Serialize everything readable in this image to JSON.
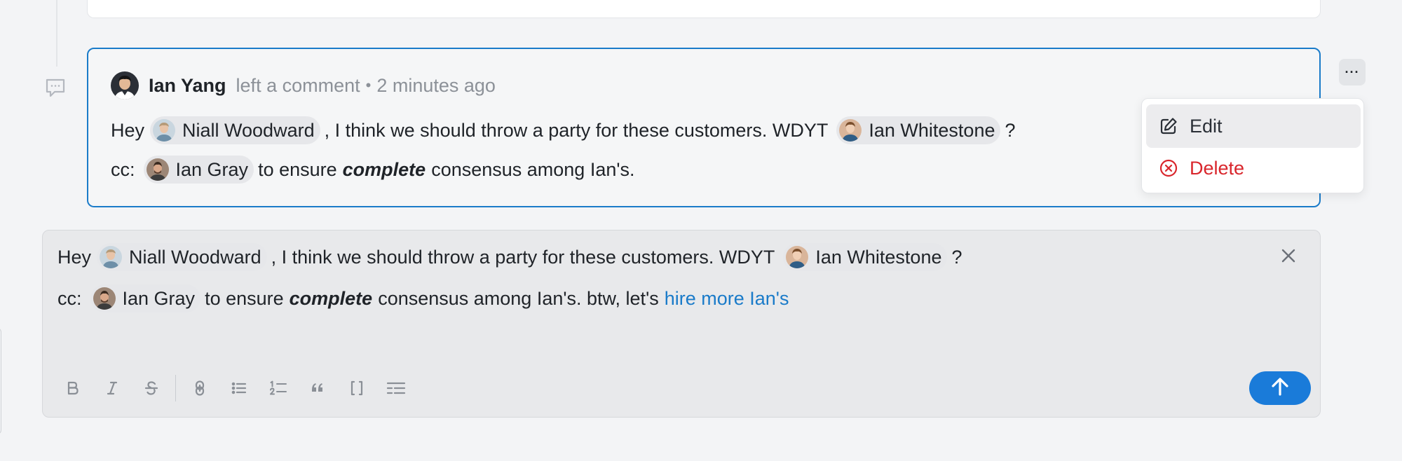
{
  "comment": {
    "author": "Ian Yang",
    "action": "left a comment",
    "separator": "•",
    "time": "2 minutes ago",
    "line1": {
      "pre": "Hey",
      "mention1": "Niall Woodward",
      "mid": ", I think we should throw a party for these customers. WDYT",
      "mention2": "Ian Whitestone",
      "end": "?"
    },
    "line2": {
      "cc": "cc:",
      "mention": "Ian Gray",
      "pre": "to ensure",
      "emph": "complete",
      "post": "consensus among Ian's."
    }
  },
  "menu": {
    "more_label": "···",
    "edit": "Edit",
    "delete": "Delete"
  },
  "editor": {
    "line1": {
      "pre": "Hey",
      "mention1": "Niall Woodward",
      "mid": ", I think we should throw a party for these customers. WDYT",
      "mention2": "Ian Whitestone",
      "end": "?"
    },
    "line2": {
      "cc": "cc:",
      "mention": "Ian Gray",
      "pre": "to ensure",
      "emph": "complete",
      "post": "consensus among Ian's. btw, let's",
      "link": "hire more Ian's"
    }
  },
  "toolbar": {
    "icons": [
      "bold-icon",
      "italic-icon",
      "strikethrough-icon",
      "link-icon",
      "bullet-list-icon",
      "numbered-list-icon",
      "quote-icon",
      "code-icon",
      "checklist-icon"
    ]
  },
  "colors": {
    "accent": "#1a7bc9",
    "danger": "#d9262c",
    "send": "#1a7bd9"
  }
}
